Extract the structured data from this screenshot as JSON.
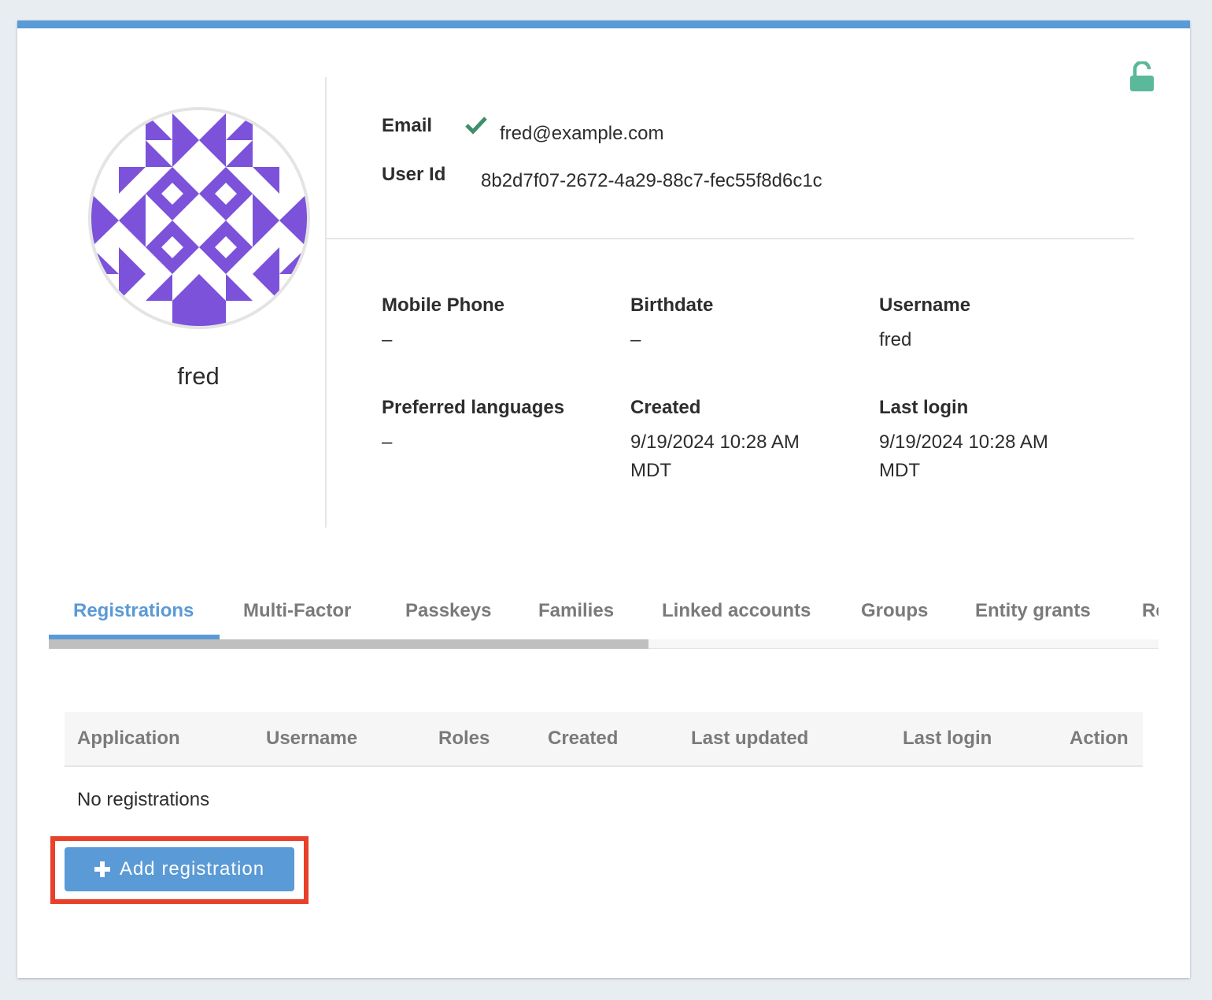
{
  "user": {
    "display_name": "fred",
    "email_label": "Email",
    "email": "fred@example.com",
    "user_id_label": "User Id",
    "user_id": "8b2d7f07-2672-4a29-88c7-fec55f8d6c1c"
  },
  "details": {
    "mobile_phone_label": "Mobile Phone",
    "mobile_phone": "–",
    "birthdate_label": "Birthdate",
    "birthdate": "–",
    "username_label": "Username",
    "username": "fred",
    "preferred_languages_label": "Preferred languages",
    "preferred_languages": "–",
    "created_label": "Created",
    "created": "9/19/2024 10:28 AM MDT",
    "last_login_label": "Last login",
    "last_login": "9/19/2024 10:28 AM MDT"
  },
  "tabs": [
    {
      "label": "Registrations",
      "active": true
    },
    {
      "label": "Multi-Factor"
    },
    {
      "label": "Passkeys"
    },
    {
      "label": "Families"
    },
    {
      "label": "Linked accounts"
    },
    {
      "label": "Groups"
    },
    {
      "label": "Entity grants"
    },
    {
      "label": "Re"
    }
  ],
  "registrations_table": {
    "columns": [
      "Application",
      "Username",
      "Roles",
      "Created",
      "Last updated",
      "Last login",
      "Action"
    ],
    "empty_message": "No registrations"
  },
  "actions": {
    "add_registration_label": "Add registration"
  },
  "icons": {
    "lock": "unlock-icon",
    "email_verified": "check-icon",
    "add": "plus-icon"
  },
  "colors": {
    "accent": "#5a9ad6",
    "avatar": "#7b52d9",
    "verified": "#3f8f6c",
    "lock": "#5bb89a",
    "highlight": "#e8402a"
  }
}
